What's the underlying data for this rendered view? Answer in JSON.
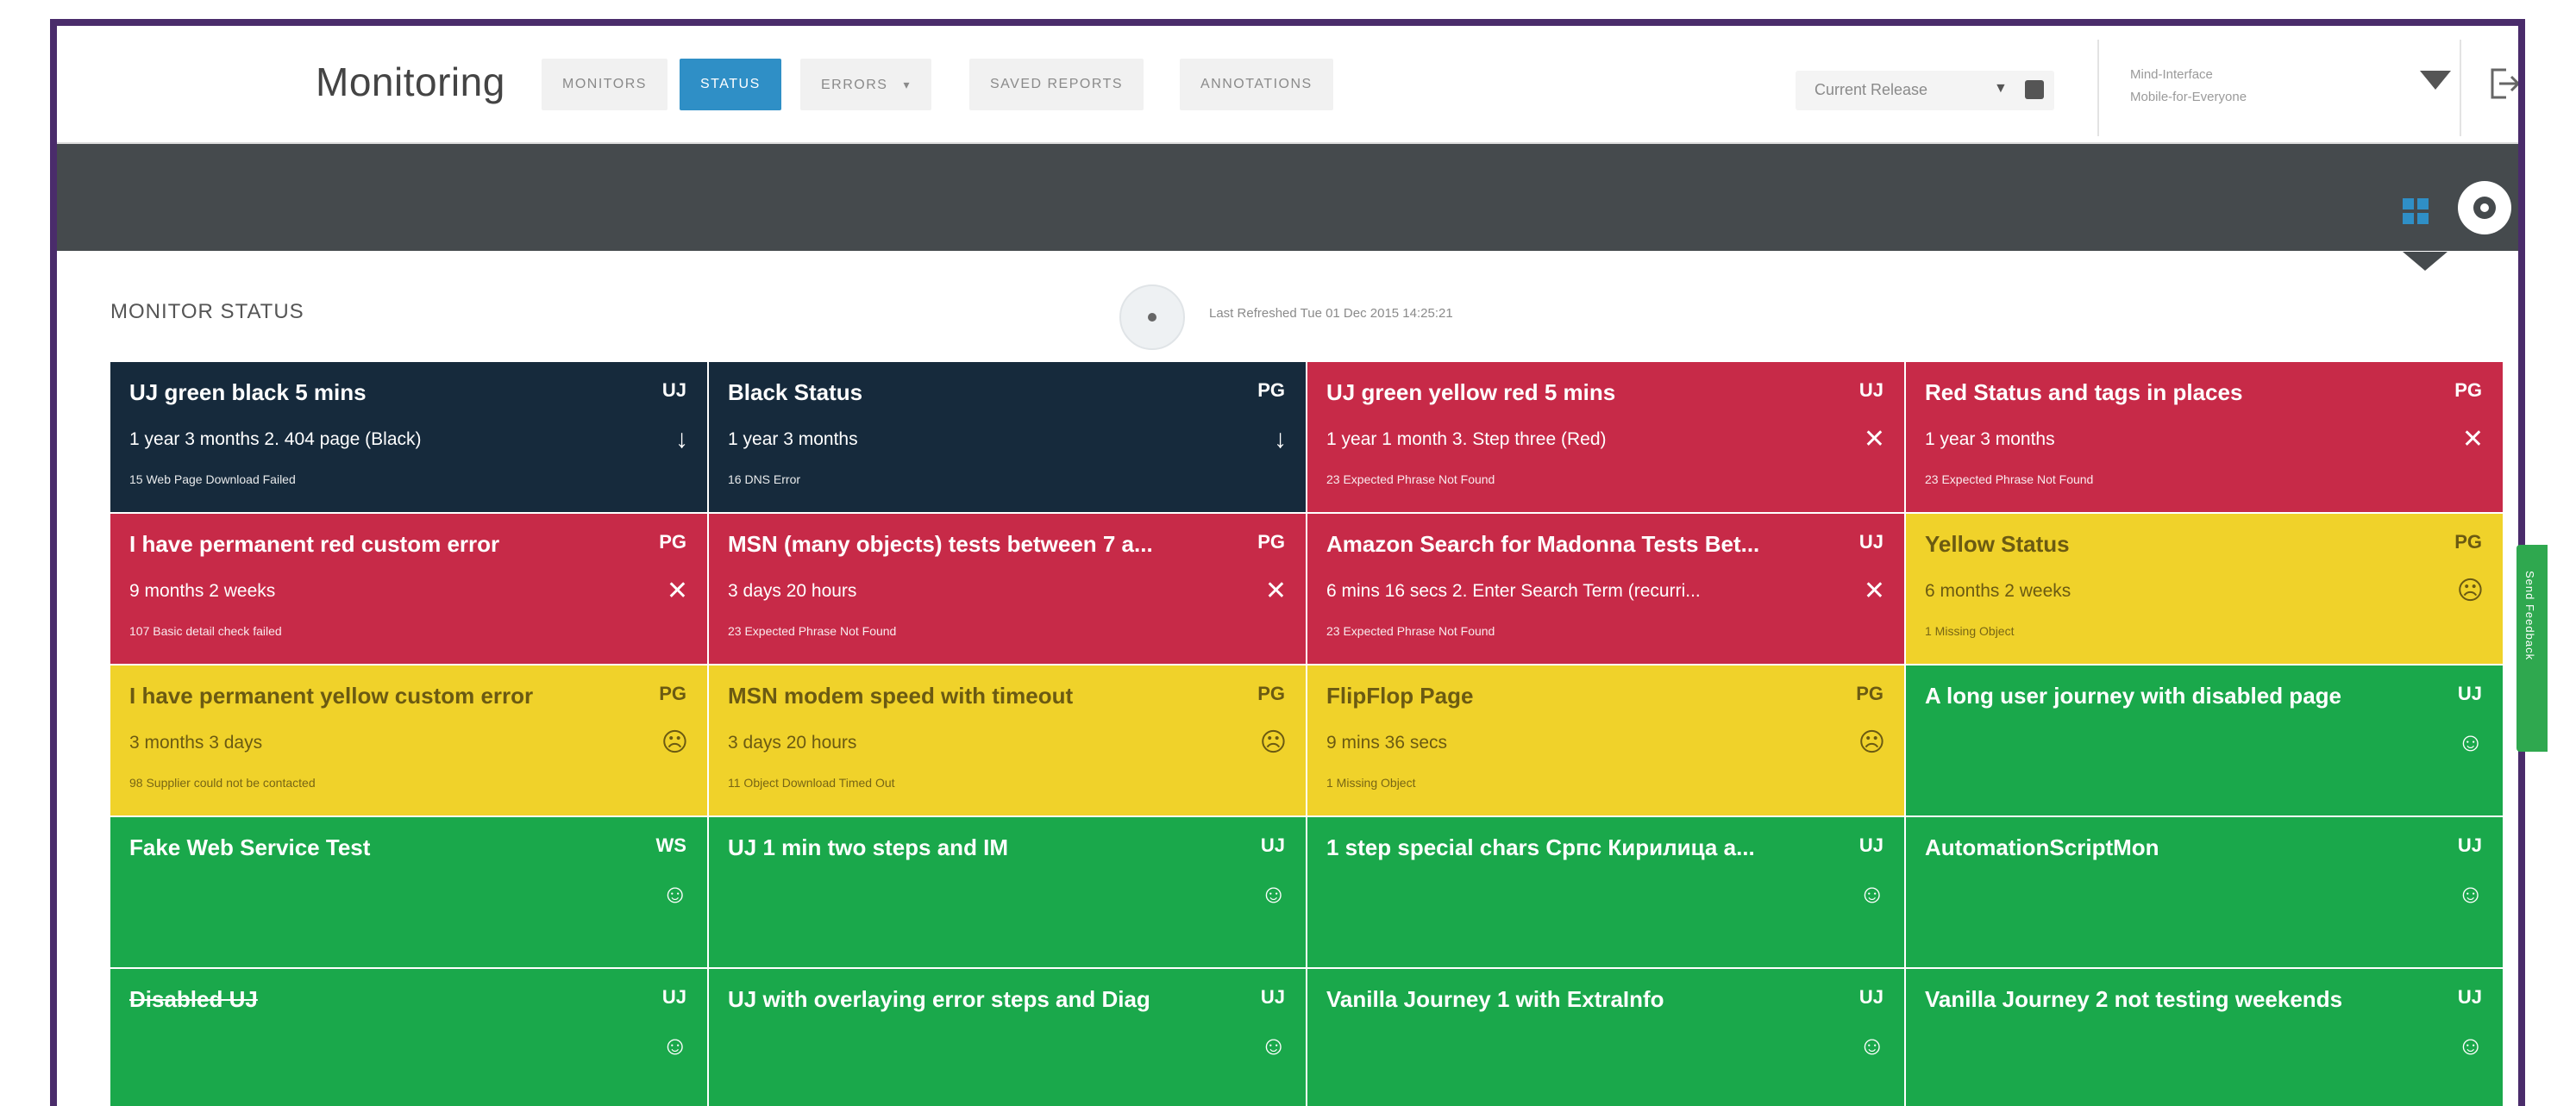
{
  "app": {
    "title": "Monitoring"
  },
  "nav": {
    "tabs": [
      {
        "label": "MONITORS",
        "active": false
      },
      {
        "label": "STATUS",
        "active": true
      },
      {
        "label": "ERRORS",
        "active": false
      },
      {
        "label": "SAVED REPORTS",
        "active": false
      },
      {
        "label": "ANNOTATIONS",
        "active": false
      }
    ],
    "release_label": "Current Release",
    "user_line1": "Mind-Interface",
    "user_line2": "Mobile-for-Everyone"
  },
  "status": {
    "section_title": "MONITOR STATUS",
    "last_refreshed": "Last Refreshed Tue 01 Dec 2015 14:25:21"
  },
  "sidetab": {
    "label": "Send Feedback"
  },
  "colors": {
    "black": "#162a3c",
    "red": "#c72a48",
    "yellow": "#f0d22a",
    "green": "#1aa84b",
    "accent": "#2f8fc6"
  },
  "tiles": [
    {
      "name": "UJ green black 5 mins",
      "type": "UJ",
      "duration": "1 year 3 months  2. 404 page (Black)",
      "error": "15  Web Page Download Failed",
      "status": "black",
      "indicator": "↓"
    },
    {
      "name": "Black Status",
      "type": "PG",
      "duration": "1 year 3 months",
      "error": "16  DNS Error",
      "status": "black",
      "indicator": "↓"
    },
    {
      "name": "UJ green yellow red 5 mins",
      "type": "UJ",
      "duration": "1 year 1 month  3. Step three (Red)",
      "error": "23  Expected Phrase Not Found",
      "status": "red",
      "indicator": "✕"
    },
    {
      "name": "Red Status and tags in places",
      "type": "PG",
      "duration": "1 year 3 months",
      "error": "23  Expected Phrase Not Found",
      "status": "red",
      "indicator": "✕"
    },
    {
      "name": "I have permanent red custom error",
      "type": "PG",
      "duration": "9 months 2 weeks",
      "error": "107  Basic detail check failed",
      "status": "red",
      "indicator": "✕"
    },
    {
      "name": "MSN (many objects) tests between 7 a...",
      "type": "PG",
      "duration": "3 days 20 hours",
      "error": "23  Expected Phrase Not Found",
      "status": "red",
      "indicator": "✕"
    },
    {
      "name": "Amazon Search for Madonna Tests Bet...",
      "type": "UJ",
      "duration": "6 mins 16 secs  2. Enter Search Term (recurri...",
      "error": "23  Expected Phrase Not Found",
      "status": "red",
      "indicator": "✕"
    },
    {
      "name": "Yellow Status",
      "type": "PG",
      "duration": "6 months 2 weeks",
      "error": "1  Missing Object",
      "status": "yellow",
      "indicator": "☹"
    },
    {
      "name": "I have permanent yellow custom error",
      "type": "PG",
      "duration": "3 months 3 days",
      "error": "98  Supplier could not be contacted",
      "status": "yellow",
      "indicator": "☹"
    },
    {
      "name": "MSN modem speed with timeout",
      "type": "PG",
      "duration": "3 days 20 hours",
      "error": "11  Object Download Timed Out",
      "status": "yellow",
      "indicator": "☹"
    },
    {
      "name": "FlipFlop Page",
      "type": "PG",
      "duration": "9 mins 36 secs",
      "error": "1  Missing Object",
      "status": "yellow",
      "indicator": "☹"
    },
    {
      "name": "A long user journey with disabled page",
      "type": "UJ",
      "duration": "",
      "error": "",
      "status": "green",
      "indicator": "☺"
    },
    {
      "name": "Fake Web Service Test",
      "type": "WS",
      "duration": "",
      "error": "",
      "status": "green",
      "indicator": "☺"
    },
    {
      "name": "UJ 1 min two steps and IM",
      "type": "UJ",
      "duration": "",
      "error": "",
      "status": "green",
      "indicator": "☺"
    },
    {
      "name": "1 step special chars Српс Кирилица а...",
      "type": "UJ",
      "duration": "",
      "error": "",
      "status": "green",
      "indicator": "☺"
    },
    {
      "name": "AutomationScriptMon",
      "type": "UJ",
      "duration": "",
      "error": "",
      "status": "green",
      "indicator": "☺"
    },
    {
      "name": "Disabled UJ",
      "type": "UJ",
      "duration": "",
      "error": "",
      "status": "green",
      "indicator": "☺",
      "strike": true
    },
    {
      "name": "UJ with overlaying error steps and Diag",
      "type": "UJ",
      "duration": "",
      "error": "",
      "status": "green",
      "indicator": "☺"
    },
    {
      "name": "Vanilla Journey 1 with ExtraInfo",
      "type": "UJ",
      "duration": "",
      "error": "",
      "status": "green",
      "indicator": "☺"
    },
    {
      "name": "Vanilla Journey 2 not testing weekends",
      "type": "UJ",
      "duration": "",
      "error": "",
      "status": "green",
      "indicator": "☺"
    }
  ]
}
